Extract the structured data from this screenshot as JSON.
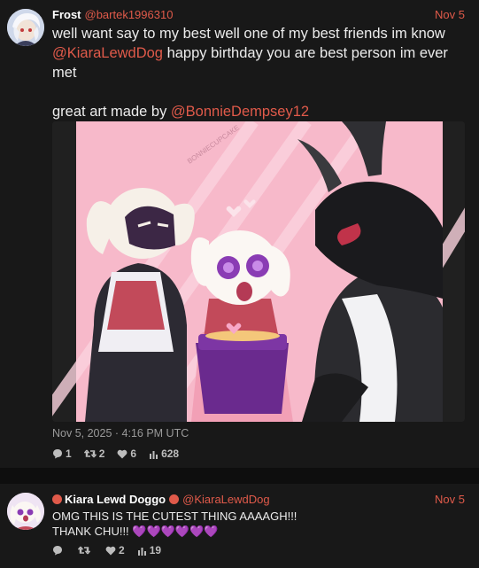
{
  "main_tweet": {
    "author_name": "Frost",
    "handle": "@bartek1996310",
    "date": "Nov 5",
    "text_part1": "well want say to my best well one of my best friends im know ",
    "mention1": "@KiaraLewdDog",
    "text_part2": " happy birthday you are best person im ever met",
    "text_part3": "great art made by ",
    "mention2": "@BonnieDempsey12",
    "media_watermark": "BONNIECUPCAKE",
    "timestamp": "Nov 5, 2025 · 4:16 PM UTC",
    "replies": "1",
    "retweets": "2",
    "likes": "6",
    "views": "628"
  },
  "reply_tweet": {
    "author_name": "Kiara Lewd Doggo",
    "handle": "@KiaraLewdDog",
    "date": "Nov 5",
    "line1": "OMG THIS IS THE CUTEST THING AAAAGH!!!",
    "line2": "THANK CHU!!! ",
    "hearts": "💜💜💜💜💜💜",
    "replies": "",
    "retweets": "",
    "likes": "2",
    "views": "19"
  },
  "colors": {
    "accent": "#e05a4a",
    "background": "#181818",
    "art_pink": "#f6b6c8"
  },
  "icons": [
    "comment-icon",
    "retweet-icon",
    "heart-icon",
    "views-icon"
  ]
}
